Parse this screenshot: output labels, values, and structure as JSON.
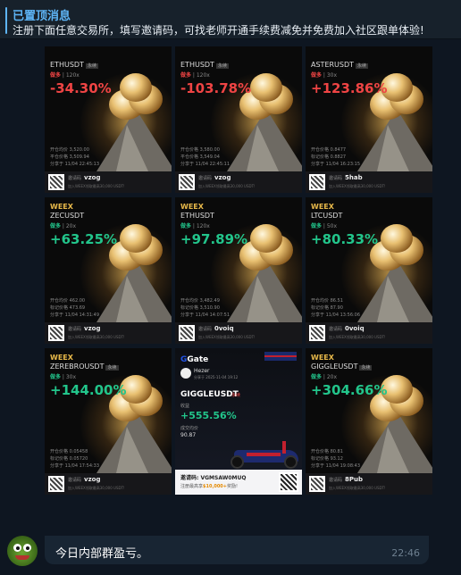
{
  "pinned": {
    "title": "已置顶消息",
    "text": "注册下面任意交易所，填写邀请码，可找老师开通手续费减免并免费加入社区跟单体验!"
  },
  "cards": [
    {
      "brand": "",
      "pair": "ETHUSDT",
      "badge": "永续",
      "direction": "做多",
      "leverage": "120x",
      "roi": "-34.30%",
      "sign": "neg",
      "open_label": "开仓均价",
      "open": "3,520.00",
      "mark_label": "平仓价格",
      "mark": "3,509.94",
      "time": "分享于 11/04 22:45:13",
      "ref_label": "邀请码",
      "code": "vzog",
      "note": "加入WEEX领取最高30,000 USDT!"
    },
    {
      "brand": "",
      "pair": "ETHUSDT",
      "badge": "永续",
      "direction": "做多",
      "leverage": "120x",
      "roi": "-103.78%",
      "sign": "neg",
      "open_label": "开仓价格",
      "open": "3,580.00",
      "mark_label": "平仓价格",
      "mark": "3,549.04",
      "time": "分享于 11/04 22:45:11",
      "ref_label": "邀请码",
      "code": "vzog",
      "note": "加入WEEX领取最高30,000 USDT!"
    },
    {
      "brand": "",
      "pair": "ASTERUSDT",
      "badge": "永续",
      "direction": "做多",
      "leverage": "30x",
      "roi": "+123.86%",
      "sign": "neg",
      "open_label": "开仓价格",
      "open": "0.8477",
      "mark_label": "标记价格",
      "mark": "0.8827",
      "time": "分享于 11/04 16:23:15",
      "ref_label": "邀请码",
      "code": "5hab",
      "note": "加入WEEX领取最高30,000 USDT!"
    },
    {
      "brand": "WEEX",
      "pair": "ZECUSDT",
      "badge": "",
      "direction": "做多",
      "leverage": "20x",
      "roi": "+63.25%",
      "sign": "pos",
      "open_label": "开仓均价",
      "open": "462.00",
      "mark_label": "标记价格",
      "mark": "473.69",
      "time": "分享于 11/04 14:31:49",
      "ref_label": "邀请码",
      "code": "vzog",
      "note": "加入WEEX领取最高30,000 USDT!"
    },
    {
      "brand": "WEEX",
      "pair": "ETHUSDT",
      "badge": "",
      "direction": "做多",
      "leverage": "120x",
      "roi": "+97.89%",
      "sign": "pos",
      "open_label": "开仓均价",
      "open": "3,482.49",
      "mark_label": "标记价格",
      "mark": "3,510.90",
      "time": "分享于 11/04 14:07:51",
      "ref_label": "邀请码",
      "code": "0voiq",
      "note": "加入WEEX领取最高30,000 USDT!"
    },
    {
      "brand": "WEEX",
      "pair": "LTCUSDT",
      "badge": "",
      "direction": "做多",
      "leverage": "50x",
      "roi": "+80.33%",
      "sign": "pos",
      "open_label": "开仓均价",
      "open": "86.51",
      "mark_label": "标记价格",
      "mark": "87.90",
      "time": "分享于 11/04 13:56:06",
      "ref_label": "邀请码",
      "code": "0voiq",
      "note": "加入WEEX领取最高30,000 USDT!"
    },
    {
      "brand": "WEEX",
      "pair": "ZEREBROUSDT",
      "badge": "永续",
      "direction": "做多",
      "leverage": "30x",
      "roi": "+144.00%",
      "sign": "pos",
      "open_label": "开仓价格",
      "open": "0.05458",
      "mark_label": "标记价格",
      "mark": "0.05720",
      "time": "分享于 11/04 17:54:33",
      "ref_label": "邀请码",
      "code": "vzog",
      "note": "加入WEEX领取最高30,000 USDT!"
    },
    {
      "brand": "WEEX",
      "pair": "GIGGLEUSDT",
      "badge": "永续",
      "direction": "做多",
      "leverage": "20x",
      "roi": "+304.66%",
      "sign": "pos",
      "open_label": "开仓价格",
      "open": "80.81",
      "mark_label": "标记价格",
      "mark": "93.12",
      "time": "分享于 11/04 19:08:43",
      "ref_label": "邀请码",
      "code": "8Pub",
      "note": "加入WEEX领取最高30,000 USDT!"
    }
  ],
  "gate": {
    "brand_prefix": "G",
    "brand": "Gate",
    "user": "Hezer",
    "time": "分享于 2025-11-04 19:12",
    "pair": "GIGGLEUSDT",
    "tag": "永续",
    "roi_label": "收益",
    "roi": "+555.56%",
    "price_label": "成交均价",
    "price": "90.87",
    "ref": "邀请码: VGMSAW0MUQ",
    "note_pre": "注册最高享",
    "note_bonus": "$10,000+",
    "note_post": "奖励!"
  },
  "message": {
    "text": "今日内部群盈亏。",
    "time": "22:46"
  }
}
